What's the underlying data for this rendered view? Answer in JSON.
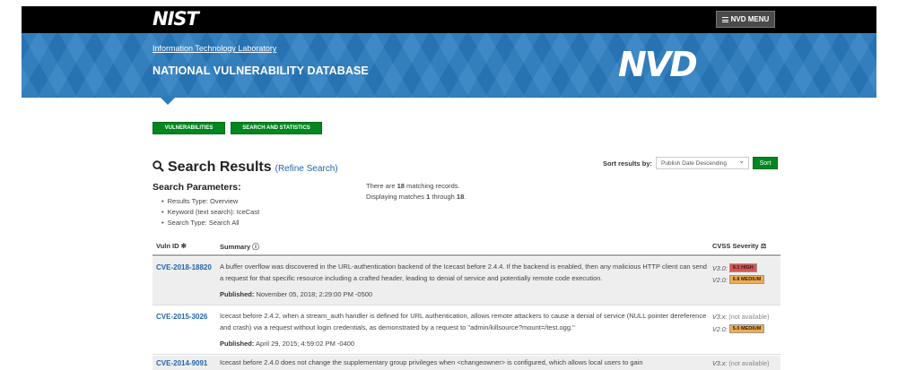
{
  "header": {
    "logo_text": "NIST",
    "menu_label": "NVD MENU",
    "itl_link": "Information Technology Laboratory",
    "site_title": "NATIONAL VULNERABILITY DATABASE",
    "nvd_logo": "NVD"
  },
  "nav": {
    "vulnerabilities": "VULNERABILITIES",
    "search_stats": "SEARCH AND STATISTICS"
  },
  "results": {
    "title": "Search Results",
    "refine": "(Refine Search)",
    "params_title": "Search Parameters:",
    "params": [
      "Results Type: Overview",
      "Keyword (text search): IceCast",
      "Search Type: Search All"
    ],
    "match_pre": "There are ",
    "match_count": "18",
    "match_post": " matching records.",
    "display_pre": "Displaying matches ",
    "display_from": "1",
    "display_mid": " through ",
    "display_to": "18",
    "display_post": "."
  },
  "sort": {
    "label": "Sort results by:",
    "selected": "Publish Date Descending",
    "button": "Sort"
  },
  "table": {
    "col_vuln": "Vuln ID",
    "col_summary": "Summary",
    "col_cvss": "CVSS Severity",
    "rows": [
      {
        "id": "CVE-2018-18820",
        "summary": "A buffer overflow was discovered in the URL-authentication backend of the Icecast before 2.4.4. If the backend is enabled, then any malicious HTTP client can send a request for that specific resource including a crafted header, leading to denial of service and potentially remote code execution.",
        "published_label": "Published:",
        "published": "November 05, 2018; 2:29:00 PM -0500",
        "v3_label": "V3.0:",
        "v3": "9.1 HIGH",
        "v2_label": "V2.0:",
        "v2": "6.8 MEDIUM"
      },
      {
        "id": "CVE-2015-3026",
        "summary": "Icecast before 2.4.2, when a stream_auth handler is defined for URL authentication, allows remote attackers to cause a denial of service (NULL pointer dereference and crash) via a request without login credentials, as demonstrated by a request to \"admin/killsource?mount=/test.ogg.\"",
        "published_label": "Published:",
        "published": "April 29, 2015; 4:59:02 PM -0400",
        "v3_label": "V3.x:",
        "v3": "(not available)",
        "v2_label": "V2.0:",
        "v2": "5.0 MEDIUM"
      },
      {
        "id": "CVE-2014-9091",
        "summary": "Icecast before 2.4.0 does not change the supplementary group privileges when <changeowner> is configured, which allows local users to gain",
        "v3_label": "V3.x:",
        "v3": "(not available)"
      }
    ]
  },
  "colors": {
    "banner": "#2a7cc0",
    "green": "#00881e",
    "link": "#2166ac",
    "high": "#d9534f",
    "medium": "#f0ad4e"
  }
}
